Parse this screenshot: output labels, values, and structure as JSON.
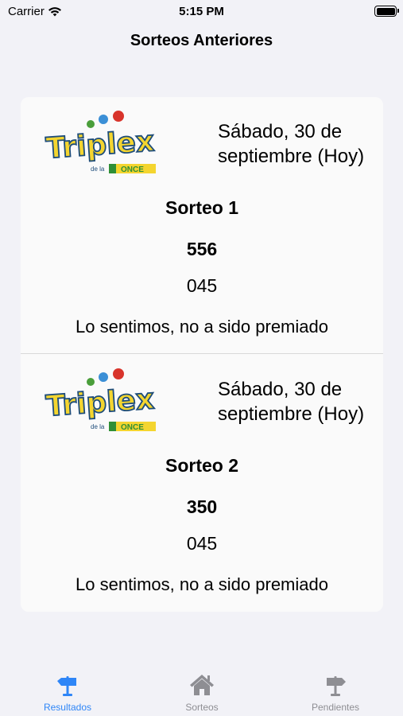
{
  "status": {
    "carrier": "Carrier",
    "time": "5:15 PM"
  },
  "nav": {
    "title": "Sorteos Anteriores"
  },
  "draws": [
    {
      "logo": {
        "word": "Triplex",
        "sub": "de la",
        "brand": "ONCE"
      },
      "date": "Sábado, 30 de septiembre (Hoy)",
      "title": "Sorteo 1",
      "number": "556",
      "secondary": "045",
      "result": "Lo sentimos, no a sido premiado"
    },
    {
      "logo": {
        "word": "Triplex",
        "sub": "de la",
        "brand": "ONCE"
      },
      "date": "Sábado, 30 de septiembre (Hoy)",
      "title": "Sorteo 2",
      "number": "350",
      "secondary": "045",
      "result": "Lo sentimos, no a sido premiado"
    }
  ],
  "tabs": [
    {
      "label": "Resultados",
      "icon": "signpost-left-icon",
      "active": true
    },
    {
      "label": "Sorteos",
      "icon": "house-icon",
      "active": false
    },
    {
      "label": "Pendientes",
      "icon": "signpost-right-icon",
      "active": false
    }
  ],
  "colors": {
    "accent": "#2f86f7",
    "inactive": "#8e8e93",
    "background": "#f2f2f7",
    "card": "#fafafa"
  }
}
